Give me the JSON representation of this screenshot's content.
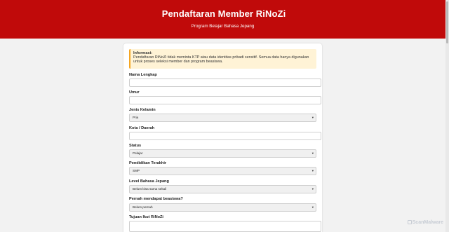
{
  "header": {
    "icon": "",
    "title": "Pendaftaran Member RiNoZi",
    "subtitle": "Program Belajar Bahasa Jepang"
  },
  "info": {
    "title": "Informasi:",
    "text": "Pendaftaran RiNoZi tidak meminta KTP atau data identitas pribadi sensitif. Semua data hanya digunakan untuk proses seleksi member dan program beasiswa."
  },
  "form": {
    "nama_label": "Nama Lengkap",
    "nama_value": "",
    "umur_label": "Umur",
    "umur_value": "",
    "gender_label": "Jenis Kelamin",
    "gender_value": "Pria",
    "kota_label": "Kota / Daerah",
    "kota_value": "",
    "status_label": "Status",
    "status_value": "Pelajar",
    "pendidikan_label": "Pendidikan Terakhir",
    "pendidikan_value": "SMP",
    "level_label": "Level Bahasa Jepang",
    "level_value": "Belum bisa sama sekali",
    "beasiswa_label": "Pernah mendapat beasiswa?",
    "beasiswa_value": "Belum pernah",
    "tujuan_label": "Tujuan Ikut RiNoZi",
    "tujuan_value": ""
  },
  "watermark": "ScanMalware",
  "colors": {
    "header_bg": "#c00a0a",
    "info_bg": "#fff3d6",
    "info_border": "#f5a623"
  }
}
